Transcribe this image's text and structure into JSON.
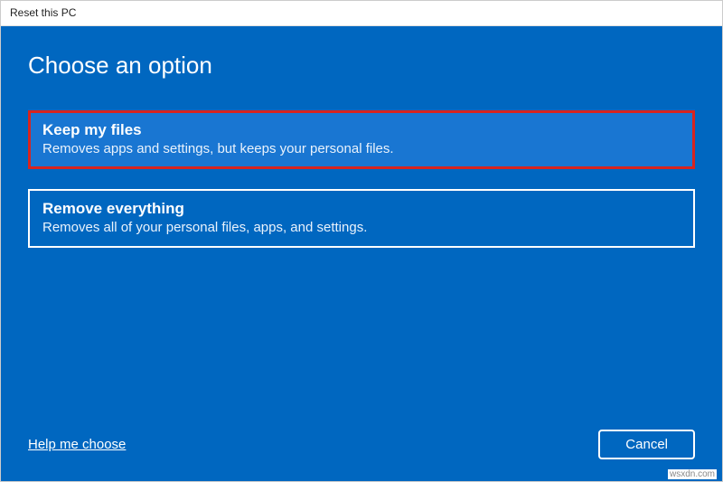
{
  "window": {
    "title": "Reset this PC"
  },
  "heading": "Choose an option",
  "options": [
    {
      "title": "Keep my files",
      "description": "Removes apps and settings, but keeps your personal files.",
      "selected": true
    },
    {
      "title": "Remove everything",
      "description": "Removes all of your personal files, apps, and settings.",
      "selected": false
    }
  ],
  "footer": {
    "help_link": "Help me choose",
    "cancel_label": "Cancel"
  },
  "watermark": "wsxdn.com"
}
